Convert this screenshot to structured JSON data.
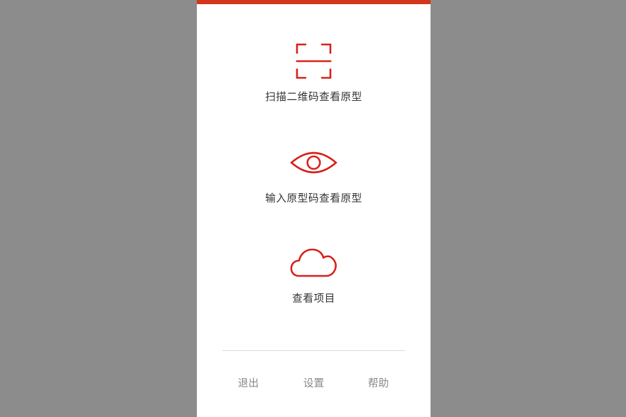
{
  "colors": {
    "accent": "#d91e18",
    "top_bar": "#d4361b",
    "background": "#8c8c8c",
    "panel": "#ffffff"
  },
  "actions": [
    {
      "icon": "scan-qr-icon",
      "label": "扫描二维码查看原型"
    },
    {
      "icon": "eye-icon",
      "label": "输入原型码查看原型"
    },
    {
      "icon": "cloud-icon",
      "label": "查看项目"
    }
  ],
  "bottom_nav": {
    "exit_label": "退出",
    "settings_label": "设置",
    "help_label": "帮助"
  }
}
